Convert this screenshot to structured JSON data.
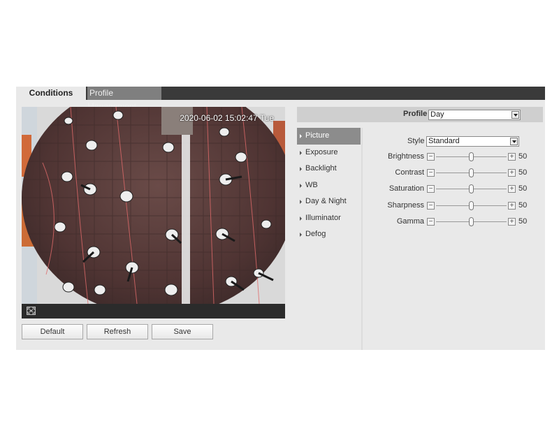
{
  "tabs": [
    {
      "label": "Conditions",
      "active": true
    },
    {
      "label": "Profile Management",
      "active": false
    }
  ],
  "video": {
    "timestamp": "2020-06-02 15:02:47 Tue",
    "fullscreen_icon": "fullscreen-icon"
  },
  "buttons": {
    "default": "Default",
    "refresh": "Refresh",
    "save": "Save"
  },
  "profile": {
    "label": "Profile",
    "value": "Day"
  },
  "menu": [
    {
      "label": "Picture",
      "active": true
    },
    {
      "label": "Exposure",
      "active": false
    },
    {
      "label": "Backlight",
      "active": false
    },
    {
      "label": "WB",
      "active": false
    },
    {
      "label": "Day & Night",
      "active": false
    },
    {
      "label": "Illuminator",
      "active": false
    },
    {
      "label": "Defog",
      "active": false
    }
  ],
  "picture": {
    "style_label": "Style",
    "style_value": "Standard",
    "sliders": [
      {
        "label": "Brightness",
        "value": 50,
        "min": 0,
        "max": 100
      },
      {
        "label": "Contrast",
        "value": 50,
        "min": 0,
        "max": 100
      },
      {
        "label": "Saturation",
        "value": 50,
        "min": 0,
        "max": 100
      },
      {
        "label": "Sharpness",
        "value": 50,
        "min": 0,
        "max": 100
      },
      {
        "label": "Gamma",
        "value": 50,
        "min": 0,
        "max": 100
      }
    ]
  },
  "colors": {
    "tabbar": "#3a3a3a",
    "active_menu": "#8c8c8c",
    "panel": "#e9e9e9"
  }
}
